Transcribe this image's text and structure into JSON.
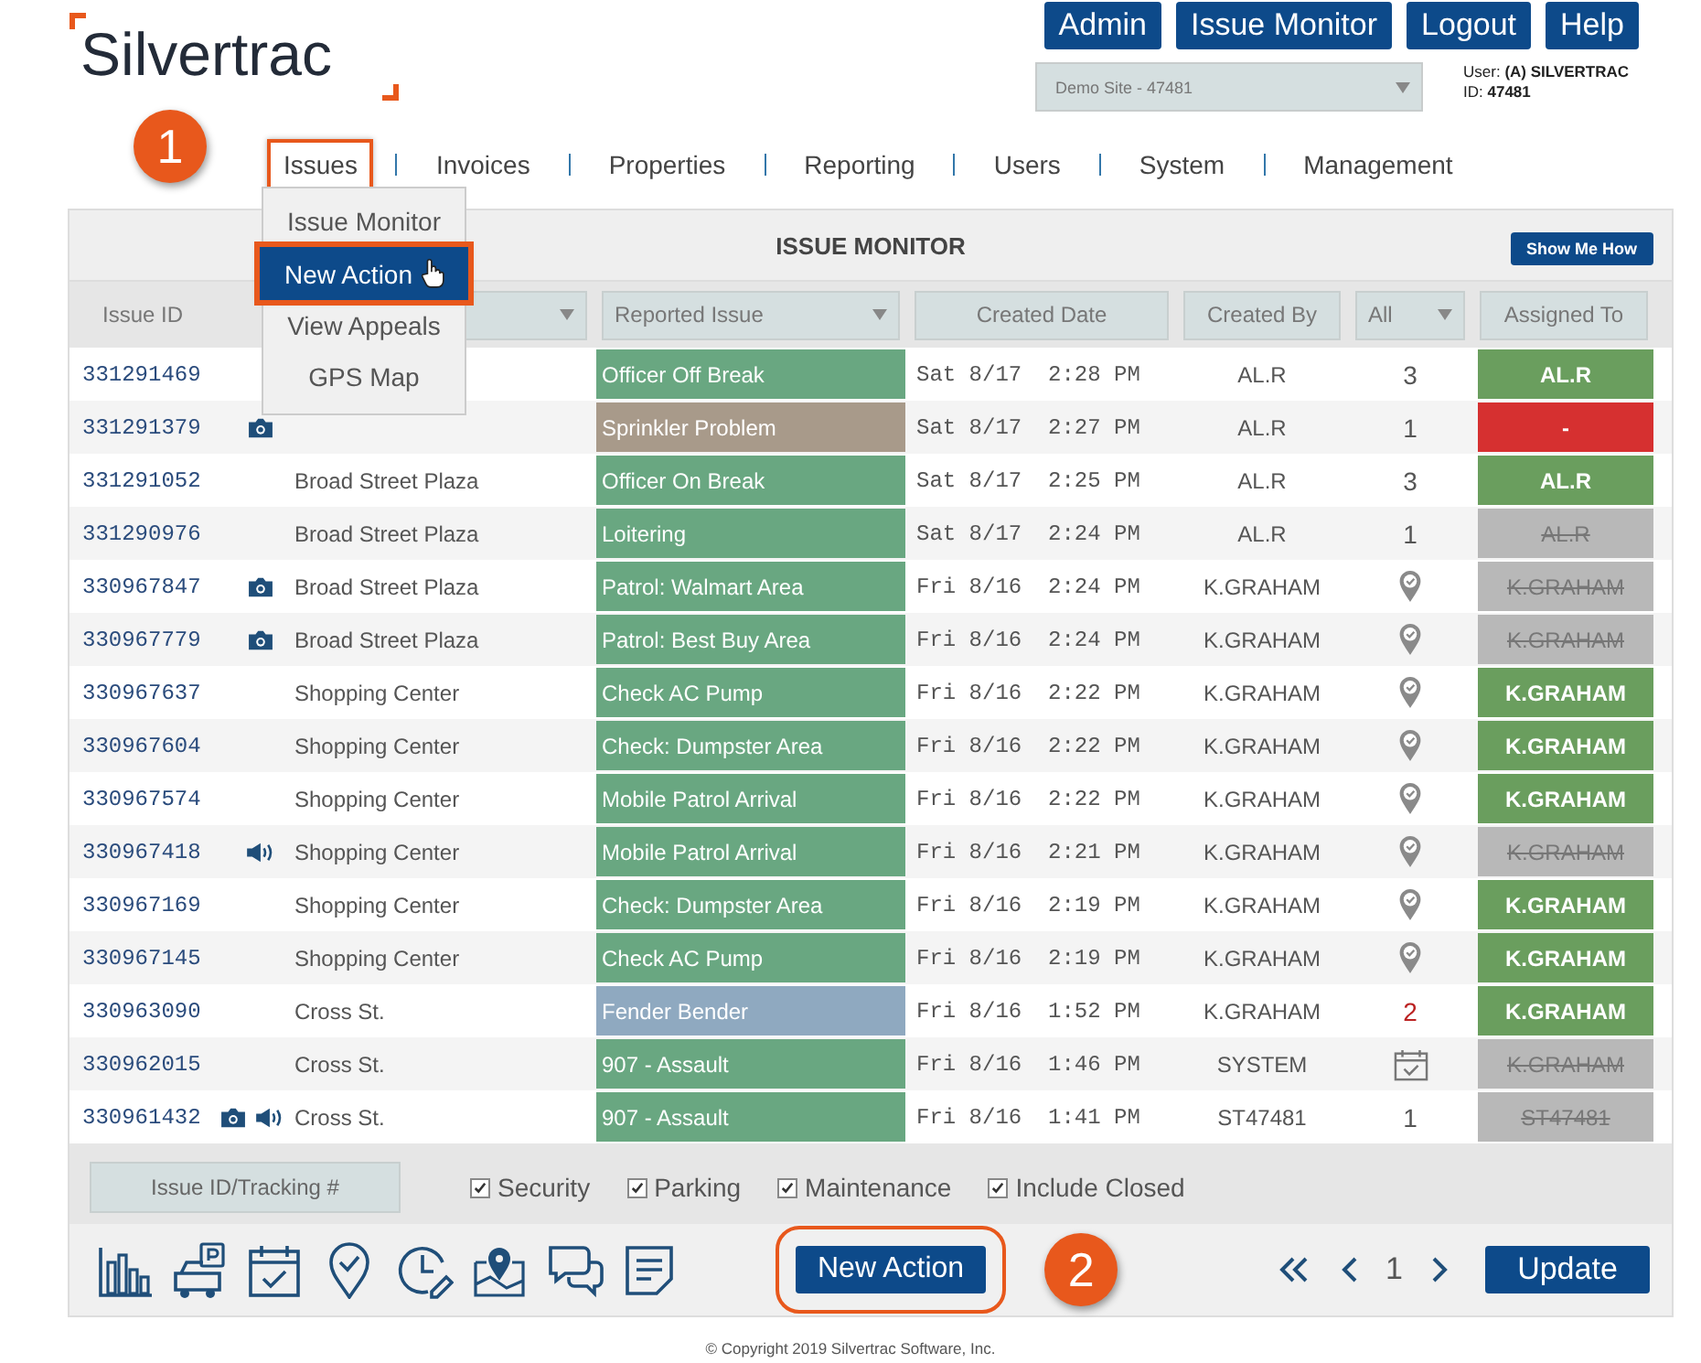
{
  "logo": "Silvertrac",
  "top_buttons": [
    "Admin",
    "Issue Monitor",
    "Logout",
    "Help"
  ],
  "site_select": {
    "value": "Demo Site - 47481"
  },
  "user": {
    "label": "User:",
    "name": "(A) SILVERTRAC",
    "id_label": "ID:",
    "id": "47481"
  },
  "nav": [
    {
      "label": "Issues",
      "selected": true
    },
    {
      "label": "Invoices",
      "selected": false
    },
    {
      "label": "Properties",
      "selected": false
    },
    {
      "label": "Reporting",
      "selected": false
    },
    {
      "label": "Users",
      "selected": false
    },
    {
      "label": "System",
      "selected": false
    },
    {
      "label": "Management",
      "selected": false
    }
  ],
  "issues_menu": [
    {
      "label": "Issue Monitor",
      "selected": false
    },
    {
      "label": "New Action",
      "selected": true
    },
    {
      "label": "View Appeals",
      "selected": false
    },
    {
      "label": "GPS Map",
      "selected": false
    }
  ],
  "callouts": [
    "1",
    "2"
  ],
  "panel": {
    "title": "ISSUE MONITOR",
    "help_button": "Show Me How"
  },
  "columns": [
    {
      "label": "Issue ID",
      "kind": "plain"
    },
    {
      "kind": "filter"
    },
    {
      "label": "Reported Issue",
      "kind": "filter"
    },
    {
      "label": "Created Date",
      "kind": "box"
    },
    {
      "label": "Created By",
      "kind": "box"
    },
    {
      "label": "All",
      "kind": "filter"
    },
    {
      "label": "Assigned To",
      "kind": "box"
    }
  ],
  "rows": [
    {
      "id": "331291469",
      "camera": false,
      "audio": false,
      "issue": "Officer Off Break",
      "color": "#69a781",
      "date": "Sat 8/17  2:28 PM",
      "created_by": "AL.R",
      "status": {
        "kind": "count",
        "text": "3"
      },
      "assigned": {
        "kind": "open",
        "text": "AL.R"
      }
    },
    {
      "id": "331291379",
      "camera": true,
      "audio": false,
      "issue": "Sprinkler Problem",
      "color": "#a89a8a",
      "date": "Sat 8/17  2:27 PM",
      "created_by": "AL.R",
      "status": {
        "kind": "count",
        "text": "1"
      },
      "assigned": {
        "kind": "unassigned",
        "text": "-"
      }
    },
    {
      "id": "331291052",
      "camera": false,
      "audio": false,
      "site": "Broad Street Plaza",
      "issue": "Officer On Break",
      "color": "#69a781",
      "date": "Sat 8/17  2:25 PM",
      "created_by": "AL.R",
      "status": {
        "kind": "count",
        "text": "3"
      },
      "assigned": {
        "kind": "open",
        "text": "AL.R"
      }
    },
    {
      "id": "331290976",
      "camera": false,
      "audio": false,
      "site": "Broad Street Plaza",
      "issue": "Loitering",
      "color": "#69a781",
      "date": "Sat 8/17  2:24 PM",
      "created_by": "AL.R",
      "status": {
        "kind": "count",
        "text": "1"
      },
      "assigned": {
        "kind": "closed",
        "text": "AL.R"
      }
    },
    {
      "id": "330967847",
      "camera": true,
      "audio": false,
      "site": "Broad Street Plaza",
      "issue": "Patrol: Walmart Area",
      "color": "#69a781",
      "date": "Fri 8/16  2:24 PM",
      "created_by": "K.GRAHAM",
      "status": {
        "kind": "gps"
      },
      "assigned": {
        "kind": "closed",
        "text": "K.GRAHAM"
      }
    },
    {
      "id": "330967779",
      "camera": true,
      "audio": false,
      "site": "Broad Street Plaza",
      "issue": "Patrol: Best Buy Area",
      "color": "#69a781",
      "date": "Fri 8/16  2:24 PM",
      "created_by": "K.GRAHAM",
      "status": {
        "kind": "gps"
      },
      "assigned": {
        "kind": "closed",
        "text": "K.GRAHAM"
      }
    },
    {
      "id": "330967637",
      "camera": false,
      "audio": false,
      "site": "Shopping Center",
      "issue": "Check AC Pump",
      "color": "#69a781",
      "date": "Fri 8/16  2:22 PM",
      "created_by": "K.GRAHAM",
      "status": {
        "kind": "gps"
      },
      "assigned": {
        "kind": "open",
        "text": "K.GRAHAM"
      }
    },
    {
      "id": "330967604",
      "camera": false,
      "audio": false,
      "site": "Shopping Center",
      "issue": "Check: Dumpster Area",
      "color": "#69a781",
      "date": "Fri 8/16  2:22 PM",
      "created_by": "K.GRAHAM",
      "status": {
        "kind": "gps"
      },
      "assigned": {
        "kind": "open",
        "text": "K.GRAHAM"
      }
    },
    {
      "id": "330967574",
      "camera": false,
      "audio": false,
      "site": "Shopping Center",
      "issue": "Mobile Patrol Arrival",
      "color": "#69a781",
      "date": "Fri 8/16  2:22 PM",
      "created_by": "K.GRAHAM",
      "status": {
        "kind": "gps"
      },
      "assigned": {
        "kind": "open",
        "text": "K.GRAHAM"
      }
    },
    {
      "id": "330967418",
      "camera": false,
      "audio": true,
      "site": "Shopping Center",
      "issue": "Mobile Patrol Arrival",
      "color": "#69a781",
      "date": "Fri 8/16  2:21 PM",
      "created_by": "K.GRAHAM",
      "status": {
        "kind": "gps"
      },
      "assigned": {
        "kind": "closed",
        "text": "K.GRAHAM"
      }
    },
    {
      "id": "330967169",
      "camera": false,
      "audio": false,
      "site": "Shopping Center",
      "issue": "Check: Dumpster Area",
      "color": "#69a781",
      "date": "Fri 8/16  2:19 PM",
      "created_by": "K.GRAHAM",
      "status": {
        "kind": "gps"
      },
      "assigned": {
        "kind": "open",
        "text": "K.GRAHAM"
      }
    },
    {
      "id": "330967145",
      "camera": false,
      "audio": false,
      "site": "Shopping Center",
      "issue": "Check AC Pump",
      "color": "#69a781",
      "date": "Fri 8/16  2:19 PM",
      "created_by": "K.GRAHAM",
      "status": {
        "kind": "gps"
      },
      "assigned": {
        "kind": "open",
        "text": "K.GRAHAM"
      }
    },
    {
      "id": "330963090",
      "camera": false,
      "audio": false,
      "site": "Cross St.",
      "issue": "Fender Bender",
      "color": "#8fa9c0",
      "date": "Fri 8/16  1:52 PM",
      "created_by": "K.GRAHAM",
      "status": {
        "kind": "alert",
        "text": "2"
      },
      "assigned": {
        "kind": "open",
        "text": "K.GRAHAM"
      }
    },
    {
      "id": "330962015",
      "camera": false,
      "audio": false,
      "site": "Cross St.",
      "issue": "907 - Assault",
      "color": "#69a781",
      "date": "Fri 8/16  1:46 PM",
      "created_by": "SYSTEM",
      "status": {
        "kind": "calendar"
      },
      "assigned": {
        "kind": "closed",
        "text": "K.GRAHAM"
      }
    },
    {
      "id": "330961432",
      "camera": true,
      "audio": true,
      "site": "Cross St.",
      "issue": "907 - Assault",
      "color": "#69a781",
      "date": "Fri 8/16  1:41 PM",
      "created_by": "ST47481",
      "status": {
        "kind": "count",
        "text": "1"
      },
      "assigned": {
        "kind": "closed",
        "text": "ST47481"
      }
    }
  ],
  "filters": {
    "search_placeholder": "Issue ID/Tracking #",
    "checks": [
      {
        "label": "Security",
        "checked": true
      },
      {
        "label": "Parking",
        "checked": true
      },
      {
        "label": "Maintenance",
        "checked": true
      },
      {
        "label": "Include Closed",
        "checked": true
      }
    ]
  },
  "new_action_button": "New Action",
  "pager": {
    "page": "1"
  },
  "update_button": "Update",
  "copyright": "© Copyright 2019 Silvertrac Software, Inc."
}
